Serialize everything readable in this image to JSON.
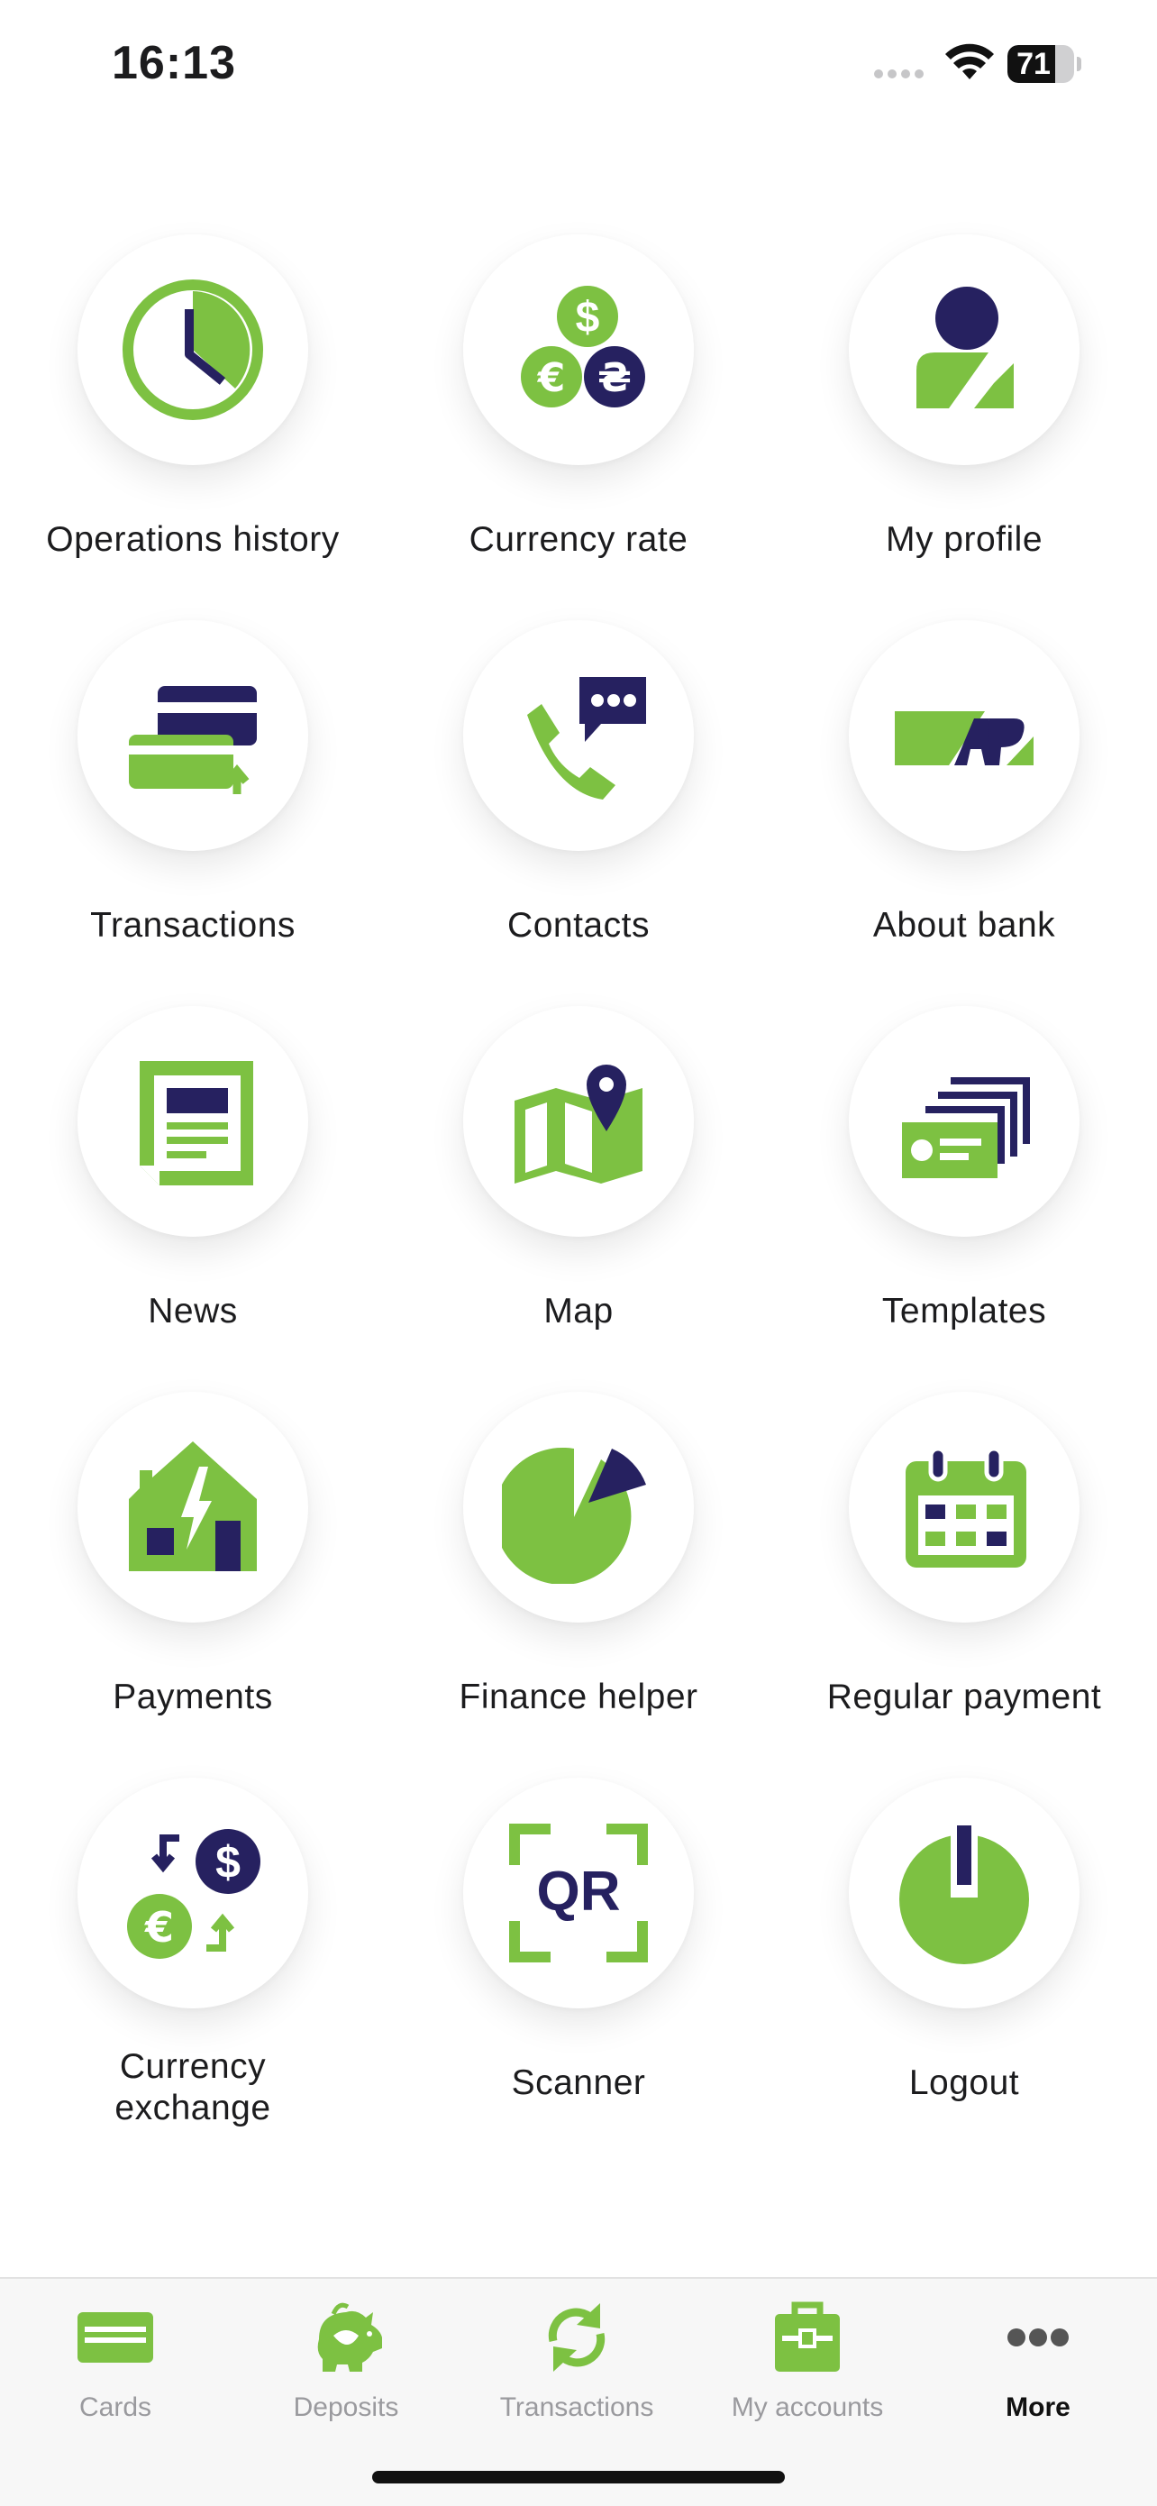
{
  "status_bar": {
    "time": "16:13",
    "battery_level": "71",
    "battery_fraction": 0.71
  },
  "colors": {
    "green": "#7DC142",
    "navy": "#262160",
    "tab_inactive": "#9a9a9e"
  },
  "menu": [
    {
      "label": "Operations history",
      "icon": "clock-icon"
    },
    {
      "label": "Currency rate",
      "icon": "currency-coins-icon"
    },
    {
      "label": "My profile",
      "icon": "user-profile-icon"
    },
    {
      "label": "Transactions",
      "icon": "cards-transfer-icon"
    },
    {
      "label": "Contacts",
      "icon": "phone-chat-icon"
    },
    {
      "label": "About bank",
      "icon": "bank-logo-icon"
    },
    {
      "label": "News",
      "icon": "newspaper-icon"
    },
    {
      "label": "Map",
      "icon": "map-pin-icon"
    },
    {
      "label": "Templates",
      "icon": "templates-cards-icon"
    },
    {
      "label": "Payments",
      "icon": "house-energy-icon"
    },
    {
      "label": "Finance helper",
      "icon": "pie-chart-icon"
    },
    {
      "label": "Regular payment",
      "icon": "calendar-icon"
    },
    {
      "label": "Currency\nexchange",
      "icon": "currency-exchange-icon"
    },
    {
      "label": "Scanner",
      "icon": "qr-scanner-icon"
    },
    {
      "label": "Logout",
      "icon": "power-icon"
    }
  ],
  "tabs": [
    {
      "label": "Cards",
      "icon": "card-icon",
      "active": false
    },
    {
      "label": "Deposits",
      "icon": "piggy-bank-icon",
      "active": false
    },
    {
      "label": "Transactions",
      "icon": "refresh-icon",
      "active": false
    },
    {
      "label": "My accounts",
      "icon": "briefcase-icon",
      "active": false
    },
    {
      "label": "More",
      "icon": "more-dots-icon",
      "active": true
    }
  ]
}
